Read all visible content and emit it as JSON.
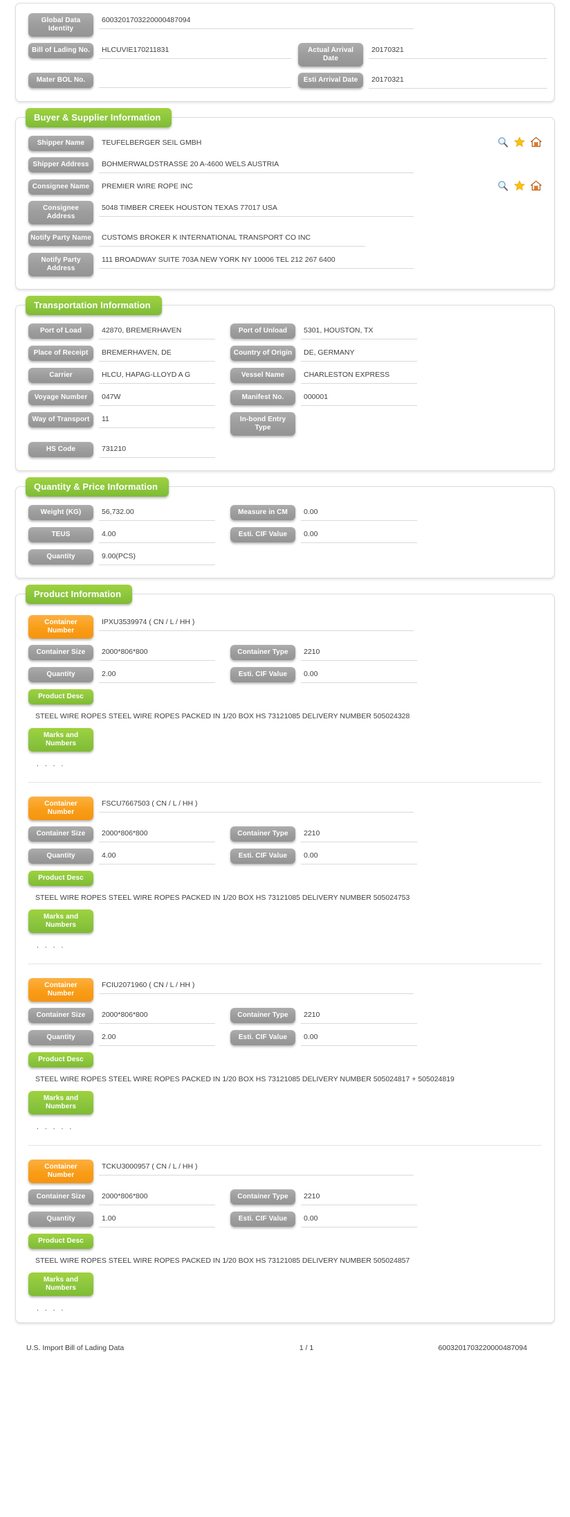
{
  "theme": {
    "accent_green": "#8cc63f",
    "accent_orange": "#f99d17",
    "label_gray": "#9d9d9d"
  },
  "header_panel": {
    "fields": {
      "global_data_identity_label": "Global Data Identity",
      "global_data_identity_value": "6003201703220000487094",
      "bill_of_lading_label": "Bill of Lading No.",
      "bill_of_lading_value": "HLCUVIE170211831",
      "actual_arrival_label": "Actual Arrival Date",
      "actual_arrival_value": "20170321",
      "master_bol_label": "Mater BOL No.",
      "master_bol_value": "",
      "esti_arrival_label": "Esti Arrival Date",
      "esti_arrival_value": "20170321"
    }
  },
  "buyer_supplier": {
    "title": "Buyer & Supplier Information",
    "fields": {
      "shipper_name_label": "Shipper Name",
      "shipper_name_value": "TEUFELBERGER SEIL GMBH",
      "shipper_address_label": "Shipper Address",
      "shipper_address_value": "BOHMERWALDSTRASSE 20 A-4600 WELS AUSTRIA",
      "consignee_name_label": "Consignee Name",
      "consignee_name_value": "PREMIER WIRE ROPE INC",
      "consignee_address_label": "Consignee Address",
      "consignee_address_value": "5048 TIMBER CREEK HOUSTON TEXAS 77017 USA",
      "notify_party_name_label": "Notify Party Name",
      "notify_party_name_value": "CUSTOMS BROKER K INTERNATIONAL TRANSPORT CO INC",
      "notify_party_address_label": "Notify Party Address",
      "notify_party_address_value": "111 BROADWAY SUITE 703A NEW YORK NY 10006 TEL 212 267 6400"
    },
    "icons": [
      "search-icon",
      "star-icon",
      "home-icon"
    ]
  },
  "transportation": {
    "title": "Transportation Information",
    "fields": {
      "port_of_load_label": "Port of Load",
      "port_of_load_value": "42870, BREMERHAVEN",
      "port_of_unload_label": "Port of Unload",
      "port_of_unload_value": "5301, HOUSTON, TX",
      "place_of_receipt_label": "Place of Receipt",
      "place_of_receipt_value": "BREMERHAVEN, DE",
      "country_of_origin_label": "Country of Origin",
      "country_of_origin_value": "DE, GERMANY",
      "carrier_label": "Carrier",
      "carrier_value": "HLCU, HAPAG-LLOYD A G",
      "vessel_name_label": "Vessel Name",
      "vessel_name_value": "CHARLESTON EXPRESS",
      "voyage_number_label": "Voyage Number",
      "voyage_number_value": "047W",
      "manifest_no_label": "Manifest No.",
      "manifest_no_value": "000001",
      "way_of_transport_label": "Way of Transport",
      "way_of_transport_value": "11",
      "in_bond_entry_type_label": "In-bond Entry Type",
      "in_bond_entry_type_value": "",
      "hs_code_label": "HS Code",
      "hs_code_value": "731210"
    }
  },
  "quantity_price": {
    "title": "Quantity & Price Information",
    "fields": {
      "weight_label": "Weight (KG)",
      "weight_value": "56,732.00",
      "measure_label": "Measure in CM",
      "measure_value": "0.00",
      "teus_label": "TEUS",
      "teus_value": "4.00",
      "esti_cif_label": "Esti. CIF Value",
      "esti_cif_value": "0.00",
      "quantity_label": "Quantity",
      "quantity_value": "9.00(PCS)"
    }
  },
  "product_information": {
    "title": "Product Information",
    "labels": {
      "container_number": "Container Number",
      "container_size": "Container Size",
      "container_type": "Container Type",
      "quantity": "Quantity",
      "esti_cif_value": "Esti. CIF Value",
      "product_desc": "Product Desc",
      "marks_and_numbers": "Marks and Numbers"
    },
    "containers": [
      {
        "container_number": "IPXU3539974 ( CN / L / HH )",
        "container_size": "2000*806*800",
        "container_type": "2210",
        "quantity": "2.00",
        "esti_cif_value": "0.00",
        "product_desc": "STEEL WIRE ROPES STEEL WIRE ROPES PACKED IN 1/20 BOX HS 73121085 DELIVERY NUMBER 505024328",
        "marks_and_numbers": ". . . ."
      },
      {
        "container_number": "FSCU7667503 ( CN / L / HH )",
        "container_size": "2000*806*800",
        "container_type": "2210",
        "quantity": "4.00",
        "esti_cif_value": "0.00",
        "product_desc": "STEEL WIRE ROPES STEEL WIRE ROPES PACKED IN 1/20 BOX HS 73121085 DELIVERY NUMBER 505024753",
        "marks_and_numbers": ". . . ."
      },
      {
        "container_number": "FCIU2071960 ( CN / L / HH )",
        "container_size": "2000*806*800",
        "container_type": "2210",
        "quantity": "2.00",
        "esti_cif_value": "0.00",
        "product_desc": "STEEL WIRE ROPES STEEL WIRE ROPES PACKED IN 1/20 BOX HS 73121085 DELIVERY NUMBER 505024817 + 505024819",
        "marks_and_numbers": ". . . . ."
      },
      {
        "container_number": "TCKU3000957 ( CN / L / HH )",
        "container_size": "2000*806*800",
        "container_type": "2210",
        "quantity": "1.00",
        "esti_cif_value": "0.00",
        "product_desc": "STEEL WIRE ROPES STEEL WIRE ROPES PACKED IN 1/20 BOX HS 73121085 DELIVERY NUMBER 505024857",
        "marks_and_numbers": ". . . ."
      }
    ]
  },
  "footer": {
    "title": "U.S. Import Bill of Lading Data",
    "page": "1 / 1",
    "identity": "6003201703220000487094"
  }
}
